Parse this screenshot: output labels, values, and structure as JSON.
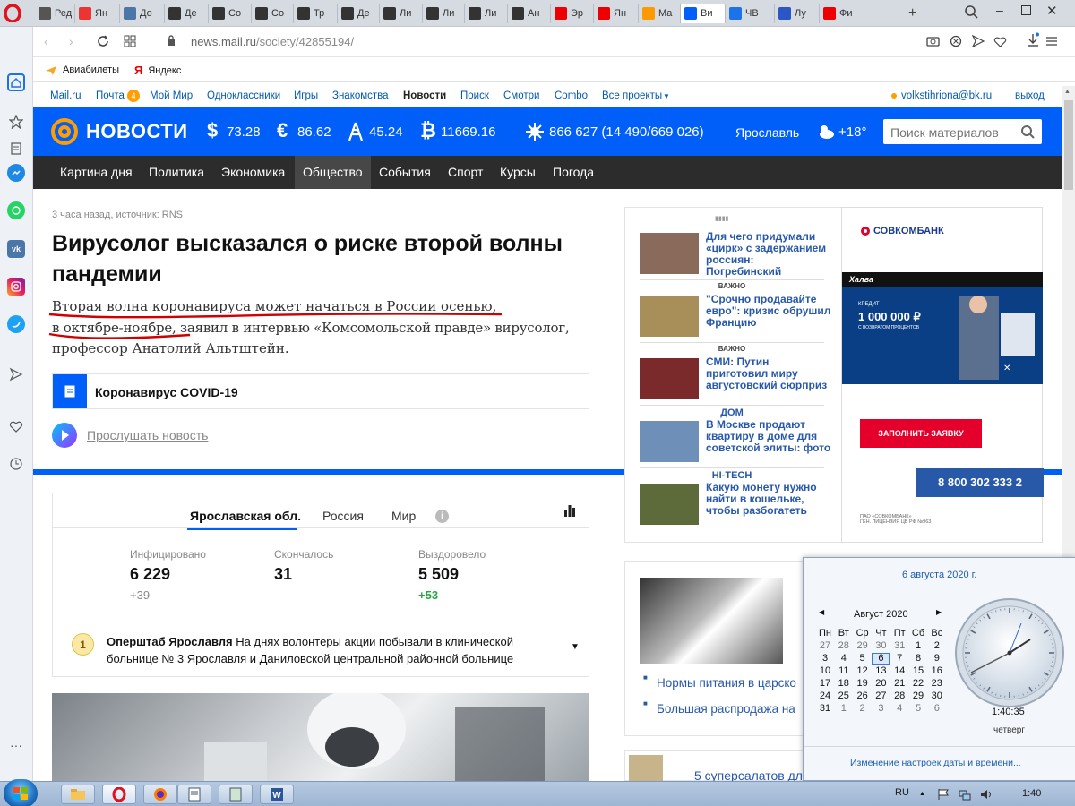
{
  "browser": {
    "tabs": [
      {
        "label": "Ред",
        "icon": "plus",
        "color": "#555"
      },
      {
        "label": "Ян",
        "icon": "map-pin",
        "color": "#e33"
      },
      {
        "label": "До",
        "icon": "vk",
        "color": "#4a76a8"
      },
      {
        "label": "Де",
        "icon": "wiki",
        "color": "#333"
      },
      {
        "label": "Со",
        "icon": "wiki",
        "color": "#333"
      },
      {
        "label": "Со",
        "icon": "wiki",
        "color": "#333"
      },
      {
        "label": "Тр",
        "icon": "wiki",
        "color": "#333"
      },
      {
        "label": "Де",
        "icon": "wiki",
        "color": "#333"
      },
      {
        "label": "Ли",
        "icon": "wiki",
        "color": "#333"
      },
      {
        "label": "Ли",
        "icon": "wiki",
        "color": "#333"
      },
      {
        "label": "Ли",
        "icon": "wiki",
        "color": "#333"
      },
      {
        "label": "Ан",
        "icon": "wiki",
        "color": "#333"
      },
      {
        "label": "Эр",
        "icon": "youtube",
        "color": "#e00"
      },
      {
        "label": "Ян",
        "icon": "yandex",
        "color": "#e00"
      },
      {
        "label": "Ма",
        "icon": "mail",
        "color": "#f90"
      },
      {
        "label": "Ви",
        "icon": "news",
        "color": "#005ff9"
      },
      {
        "label": "ЧВ",
        "icon": "search",
        "color": "#1a73e8"
      },
      {
        "label": "Лу",
        "icon": "news2",
        "color": "#2a56c6"
      },
      {
        "label": "Фи",
        "icon": "fish",
        "color": "#e00"
      }
    ],
    "url_host": "news.mail.ru",
    "url_path": "/society/42855194/",
    "bookmarks": [
      {
        "label": "Авиабилеты"
      },
      {
        "label": "Яндекс"
      }
    ]
  },
  "portal": {
    "links": [
      "Mail.ru",
      "Почта",
      "Мой Мир",
      "Одноклассники",
      "Игры",
      "Знакомства",
      "Новости",
      "Поиск",
      "Смотри",
      "Combo",
      "Все проекты"
    ],
    "mail_badge": "4",
    "user": "volkstihriona@bk.ru",
    "logout": "выход"
  },
  "header": {
    "logo": "НОВОСТИ",
    "usd": "73.28",
    "eur": "86.62",
    "oil": "45.24",
    "btc": "11669.16",
    "virus": "866 627 (14 490/669 026)",
    "city": "Ярославль",
    "temp": "+18°",
    "search_placeholder": "Поиск материалов"
  },
  "nav": [
    "Картина дня",
    "Политика",
    "Экономика",
    "Общество",
    "События",
    "Спорт",
    "Курсы",
    "Погода"
  ],
  "article": {
    "meta": "3 часа назад, источник: ",
    "source": "RNS",
    "title_l1": "Вирусолог высказался о риске второй волны",
    "title_l2": "пандемии",
    "lead_l1": "Вторая волна коронавируса может начаться в России осенью,",
    "lead_l2": "в октябре-ноябре, заявил в интервью «Комсомольской правде» вирусолог,",
    "lead_l3": "профессор Анатолий Альтштейн.",
    "tag": "Коронавирус COVID-19",
    "listen": "Прослушать новость"
  },
  "stats": {
    "tabs": [
      "Ярославская обл.",
      "Россия",
      "Мир"
    ],
    "infected_label": "Инфицировано",
    "infected": "6 229",
    "infected_delta": "+39",
    "died_label": "Скончалось",
    "died": "31",
    "recovered_label": "Выздоровело",
    "recovered": "5 509",
    "recovered_delta": "+53",
    "hq_name": "Оперштаб Ярославля",
    "hq_text_l1": "На днях волонтеры акции побывали в клинической",
    "hq_text_l2": "больнице № 3 Ярославля и Даниловской центральной районной больнице"
  },
  "side": {
    "items": [
      {
        "label": "",
        "text": "Для чего придумали «цирк» с задержанием россиян: Погребинский"
      },
      {
        "label": "ВАЖНО",
        "text": "\"Срочно продавайте евро\": кризис обрушил Францию"
      },
      {
        "label": "ВАЖНО",
        "text": "СМИ: Путин приготовил миру августовский сюрприз"
      },
      {
        "label": "ДОМ",
        "text": "В Москве продают квартиру в доме для советской элиты: фото"
      },
      {
        "label": "HI-TECH",
        "text": "Какую монету нужно найти в кошельке, чтобы разбогатеть"
      }
    ],
    "links": [
      "Нормы питания в царско",
      "Большая распродажа на"
    ],
    "bottom": "5 суперсалатов дл"
  },
  "ad": {
    "bank": "СОВКОМБАНК",
    "card": "Халва",
    "credit": "КРЕДИТ",
    "amount": "1 000 000 ₽",
    "sub": "С ВОЗВРАТОМ ПРОЦЕНТОВ",
    "cta": "ЗАПОЛНИТЬ ЗАЯВКУ",
    "phone": "8 800 302 333 2",
    "license": "ПАО «СОВКОМБАНК»\nГЕН. ЛИЦЕНЗИЯ ЦБ РФ №963"
  },
  "calendar": {
    "date_title": "6 августа 2020 г.",
    "month": "Август 2020",
    "weekdays": [
      "Пн",
      "Вт",
      "Ср",
      "Чт",
      "Пт",
      "Сб",
      "Вс"
    ],
    "days": [
      27,
      28,
      29,
      30,
      31,
      1,
      2,
      3,
      4,
      5,
      6,
      7,
      8,
      9,
      10,
      11,
      12,
      13,
      14,
      15,
      16,
      17,
      18,
      19,
      20,
      21,
      22,
      23,
      24,
      25,
      26,
      27,
      28,
      29,
      30,
      31,
      1,
      2,
      3,
      4,
      5,
      6
    ],
    "time": "1:40:35",
    "weekday": "четверг",
    "change": "Изменение настроек даты и времени..."
  },
  "taskbar": {
    "lang": "RU",
    "clock": "1:40"
  },
  "colors": {
    "brand": "#005ff9",
    "nav": "#2c2c2c",
    "underline": "#d00000"
  }
}
